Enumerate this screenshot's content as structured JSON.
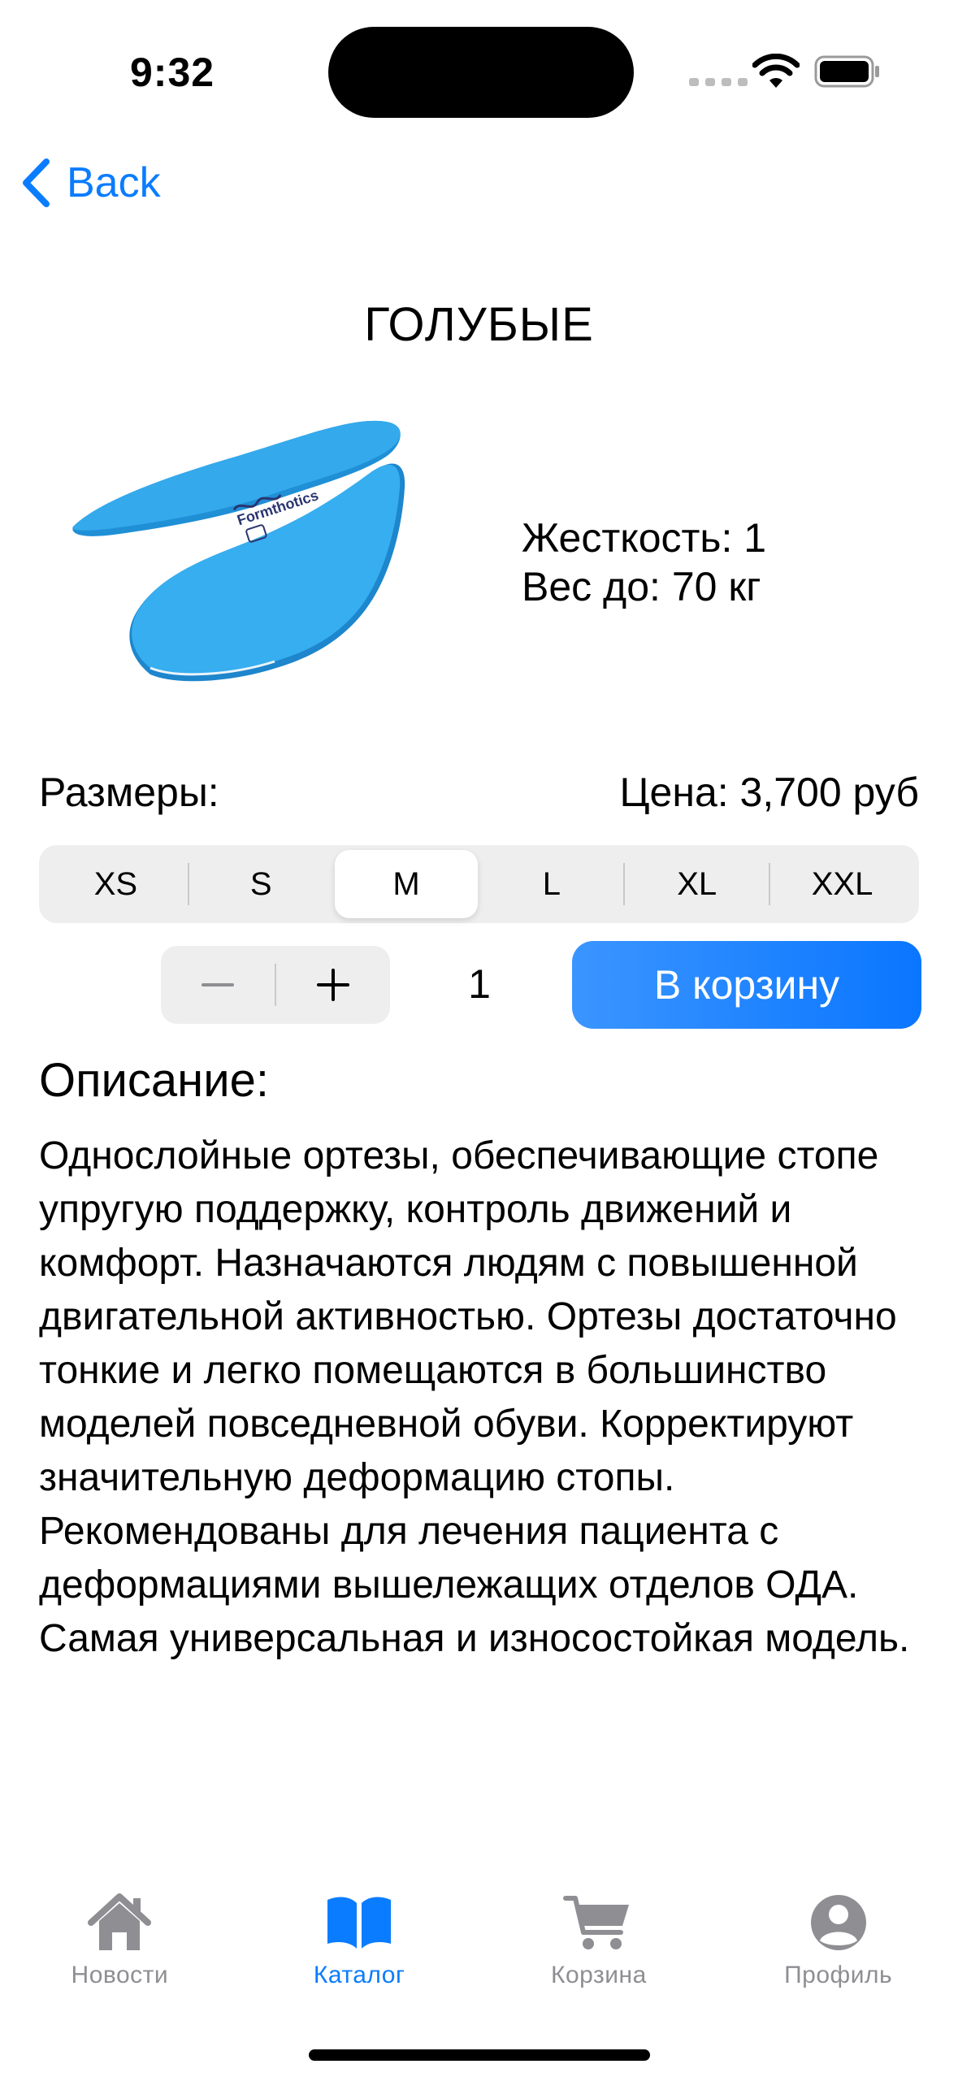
{
  "status_bar": {
    "time": "9:32"
  },
  "nav": {
    "back_label": "Back"
  },
  "product": {
    "title": "ГОЛУБЫЕ",
    "stiffness": "Жесткость: 1",
    "weight": "Вес до: 70 кг",
    "sizes_label": "Размеры:",
    "price": "Цена: 3,700 руб",
    "image_logo_text": "Formthotics",
    "image_color": "#2aa6ea"
  },
  "sizes": {
    "options": [
      "XS",
      "S",
      "M",
      "L",
      "XL",
      "XXL"
    ],
    "selected": "M"
  },
  "quantity": {
    "value": "1"
  },
  "cart_button": {
    "label": "В корзину"
  },
  "description": {
    "heading": "Описание:",
    "text": "Однослойные ортезы, обеспечивающие стопе упругую поддержку, контроль движений и комфорт. Назначаются людям с повышенной двигательной активностью. Ортезы достаточно тонкие и легко помещаются в большинство моделей повседневной обуви. Корректируют значительную деформацию стопы. Рекомендованы для лечения пациента с деформациями вышележащих отделов ОДА. Самая универсальная и износостойкая модель."
  },
  "tabbar": {
    "items": [
      {
        "label": "Новости",
        "icon": "house-icon"
      },
      {
        "label": "Каталог",
        "icon": "book-icon"
      },
      {
        "label": "Корзина",
        "icon": "cart-icon"
      },
      {
        "label": "Профиль",
        "icon": "person-icon"
      }
    ],
    "active": "Каталог"
  },
  "colors": {
    "accent": "#0a7cff",
    "inactive": "#8e8e93",
    "segment_bg": "#eeeeef"
  }
}
